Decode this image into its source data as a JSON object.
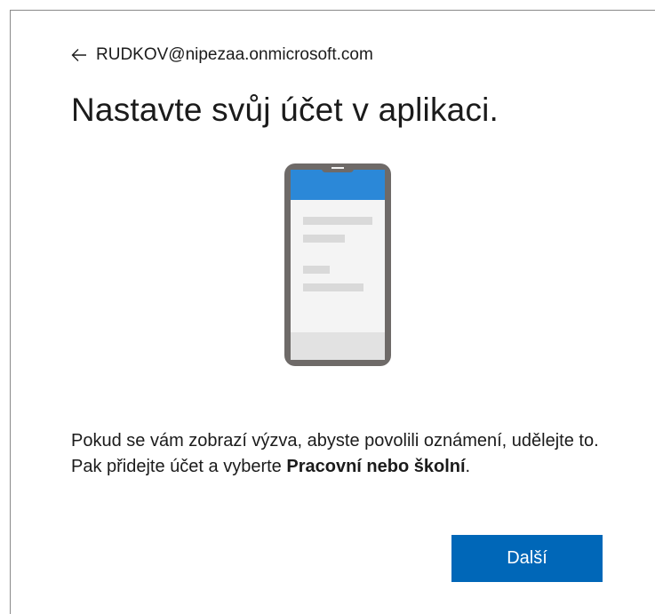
{
  "identity": {
    "email": "RUDKOV@nipezaa.onmicrosoft.com",
    "back_icon": "arrow-left-icon"
  },
  "title": "Nastavte svůj účet v aplikaci.",
  "illustration": {
    "icon": "smartphone-illustration",
    "colors": {
      "frame": "#6e6a68",
      "header": "#2b88d8",
      "screen": "#f4f4f4",
      "lines": "#d9d9d9",
      "footer": "#e2e2e2"
    }
  },
  "description": {
    "text": "Pokud se vám zobrazí výzva, abyste povolili oznámení, udělejte to. Pak přidejte účet a vyberte ",
    "bold": "Pracovní nebo školní",
    "end": "."
  },
  "buttons": {
    "next_label": "Další"
  },
  "colors": {
    "accent": "#0067b8",
    "text": "#1b1b1b"
  }
}
